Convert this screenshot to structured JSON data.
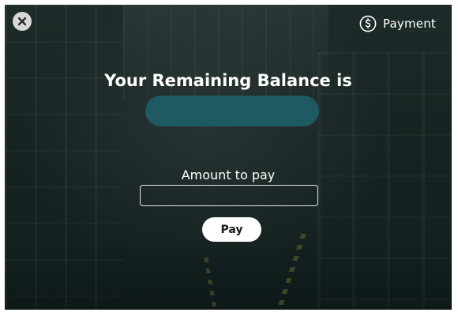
{
  "header": {
    "title": "Payment",
    "icon": "dollar-circle-icon",
    "close_icon": "close-icon"
  },
  "balance": {
    "title": "Your Remaining Balance is",
    "value": ""
  },
  "payment_form": {
    "amount_label": "Amount to pay",
    "amount_value": "",
    "amount_placeholder": "",
    "pay_button_label": "Pay"
  },
  "colors": {
    "overlay_background": "#172322",
    "balance_pill": "#1f5962",
    "text": "#ffffff",
    "button_background": "#ffffff",
    "button_text": "#1b1b1b"
  }
}
